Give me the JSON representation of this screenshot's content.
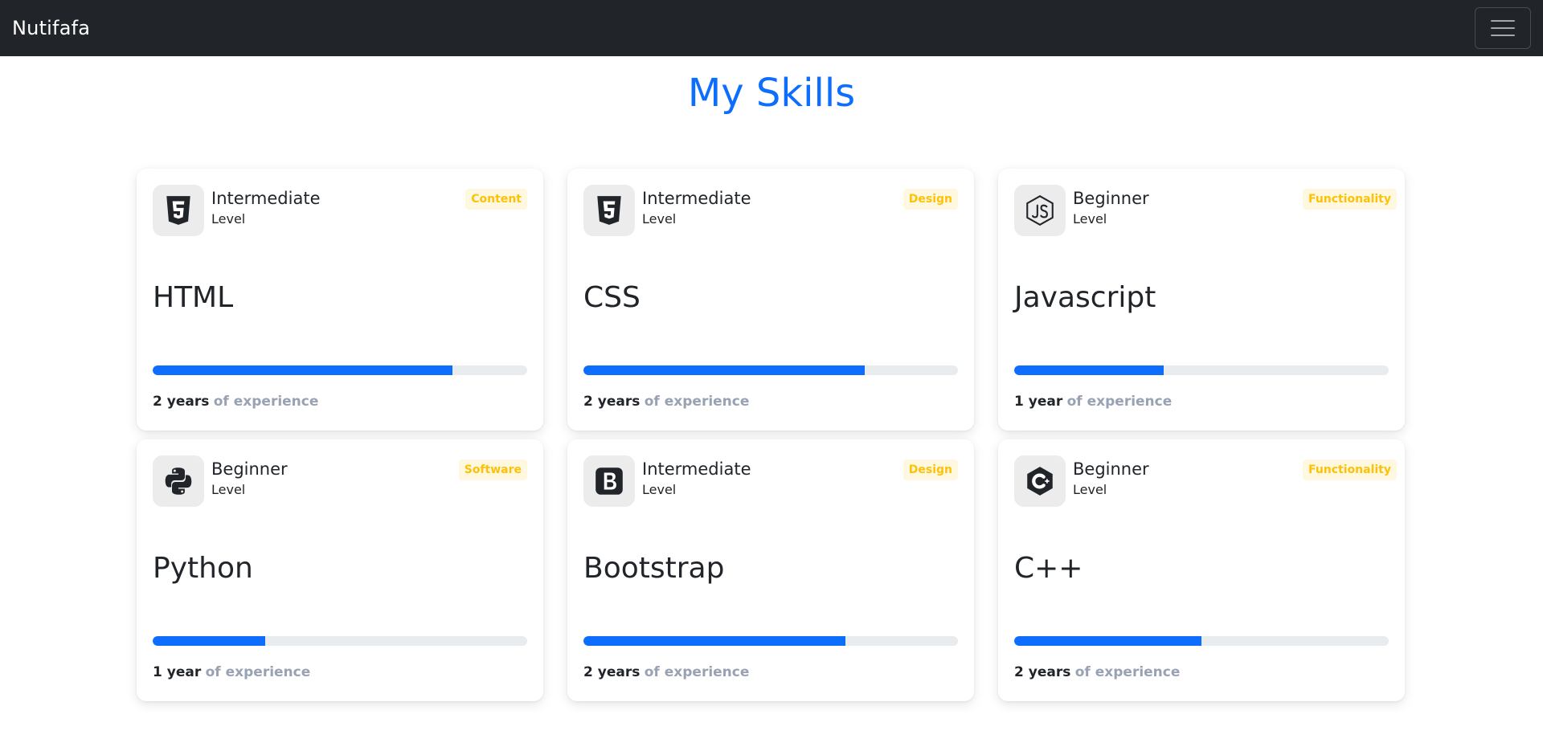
{
  "navbar": {
    "brand": "Nutifafa",
    "toggler_icon": "hamburger-menu-icon"
  },
  "page_title": "My Skills",
  "skills": [
    {
      "icon": "html5-icon",
      "level": "Intermediate",
      "level_sub": "Level",
      "category": "Content",
      "name": "HTML",
      "progress": 0.8,
      "years": "2 years",
      "experience_label": "of experience"
    },
    {
      "icon": "css3-icon",
      "level": "Intermediate",
      "level_sub": "Level",
      "category": "Design",
      "name": "CSS",
      "progress": 0.75,
      "years": "2 years",
      "experience_label": "of experience"
    },
    {
      "icon": "javascript-icon",
      "level": "Beginner",
      "level_sub": "Level",
      "category": "Functionality",
      "name": "Javascript",
      "progress": 0.4,
      "years": "1 year",
      "experience_label": "of experience"
    },
    {
      "icon": "python-icon",
      "level": "Beginner",
      "level_sub": "Level",
      "category": "Software",
      "name": "Python",
      "progress": 0.3,
      "years": "1 year",
      "experience_label": "of experience"
    },
    {
      "icon": "bootstrap-icon",
      "level": "Intermediate",
      "level_sub": "Level",
      "category": "Design",
      "name": "Bootstrap",
      "progress": 0.7,
      "years": "2 years",
      "experience_label": "of experience"
    },
    {
      "icon": "cplusplus-icon",
      "level": "Beginner",
      "level_sub": "Level",
      "category": "Functionality",
      "name": "C++",
      "progress": 0.5,
      "years": "2 years",
      "experience_label": "of experience"
    }
  ],
  "colors": {
    "navbar_bg": "#212529",
    "title": "#0d6efd",
    "progress_fill": "#0d6efd",
    "progress_track": "#e9ecef",
    "badge_text": "#ffc107",
    "badge_bg": "#fff8e1",
    "experience_muted": "#98a2b3"
  }
}
